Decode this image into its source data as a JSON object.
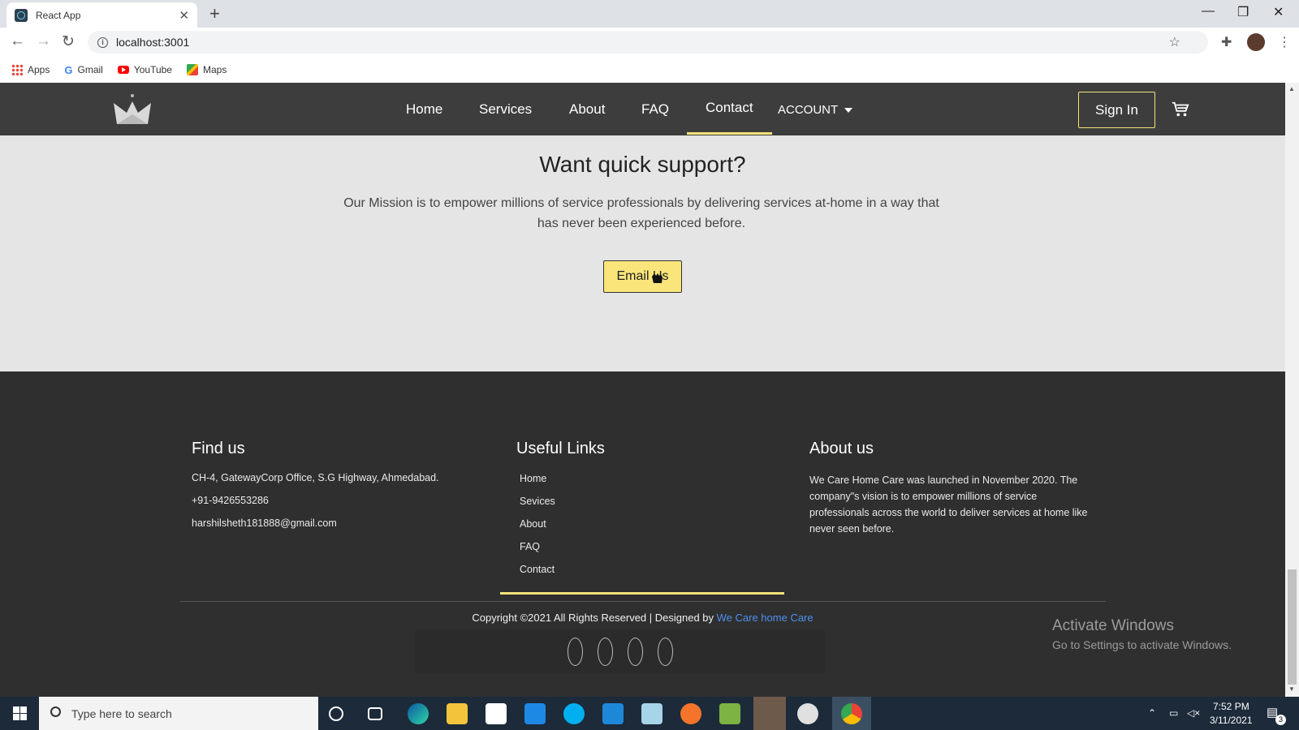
{
  "browser": {
    "tab_title": "React App",
    "url": "localhost:3001",
    "bookmarks": [
      "Apps",
      "Gmail",
      "YouTube",
      "Maps"
    ]
  },
  "nav": {
    "links": [
      "Home",
      "Services",
      "About",
      "FAQ",
      "Contact"
    ],
    "active": "Contact",
    "account": "ACCOUNT",
    "signin": "Sign In"
  },
  "support": {
    "title": "Want quick support?",
    "text": "Our Mission is to empower millions of service professionals by delivering services at-home in a way that has never been experienced before.",
    "button": "Email Us"
  },
  "footer": {
    "find_us": {
      "heading": "Find us",
      "address": "CH-4, GatewayCorp Office, S.G Highway, Ahmedabad.",
      "phone": "+91-9426553286",
      "email": "harshilsheth181888@gmail.com"
    },
    "useful_links": {
      "heading": "Useful Links",
      "links": [
        "Home",
        "Sevices",
        "About",
        "FAQ",
        "Contact"
      ]
    },
    "about_us": {
      "heading": "About us",
      "text": "We Care Home Care was launched in November 2020. The company\"s vision is to empower millions of service professionals across the world to deliver services at home like never seen before."
    },
    "copyright_prefix": "Copyright ©2021 All Rights Reserved | Designed by ",
    "copyright_brand": "We Care home Care"
  },
  "watermark": {
    "title": "Activate Windows",
    "subtitle": "Go to Settings to activate Windows."
  },
  "taskbar": {
    "search_placeholder": "Type here to search",
    "time": "7:52 PM",
    "date": "3/11/2021",
    "notification_count": "3"
  },
  "colors": {
    "nav_bg": "#3d3d3d",
    "accent": "#f5e27a",
    "footer_bg": "#2f2f2f",
    "page_bg": "#e5e5e5",
    "brand_link": "#4f8ff0"
  }
}
